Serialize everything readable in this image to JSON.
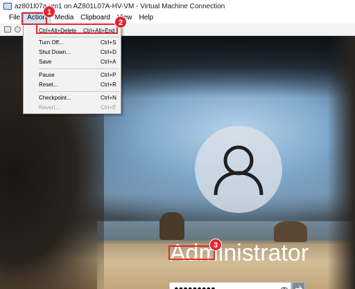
{
  "window": {
    "title": "az801l07a-vm1 on AZ801L07A-HV-VM - Virtual Machine Connection"
  },
  "menubar": {
    "items": [
      "File",
      "Action",
      "Media",
      "Clipboard",
      "View",
      "Help"
    ]
  },
  "action_menu": {
    "items": [
      {
        "label": "Ctrl+Alt+Delete",
        "shortcut": "Ctrl+Alt+End",
        "enabled": true
      },
      {
        "label": "Turn Off...",
        "shortcut": "Ctrl+S",
        "enabled": true
      },
      {
        "label": "Shut Down...",
        "shortcut": "Ctrl+D",
        "enabled": true
      },
      {
        "label": "Save",
        "shortcut": "Ctrl+A",
        "enabled": true
      },
      {
        "label": "Pause",
        "shortcut": "Ctrl+P",
        "enabled": true
      },
      {
        "label": "Reset...",
        "shortcut": "Ctrl+R",
        "enabled": true
      },
      {
        "label": "Checkpoint...",
        "shortcut": "Ctrl+N",
        "enabled": true
      },
      {
        "label": "Revert...",
        "shortcut": "Ctrl+E",
        "enabled": false
      }
    ]
  },
  "lock_screen": {
    "username": "Administrator",
    "password_masked": "●●●●●●●●●",
    "icons": {
      "avatar": "user-avatar-icon",
      "reveal": "eye-icon",
      "submit": "arrow-right-icon"
    }
  },
  "callouts": {
    "step1": "1",
    "step2": "2",
    "step3": "3",
    "color": "#e0262f"
  }
}
